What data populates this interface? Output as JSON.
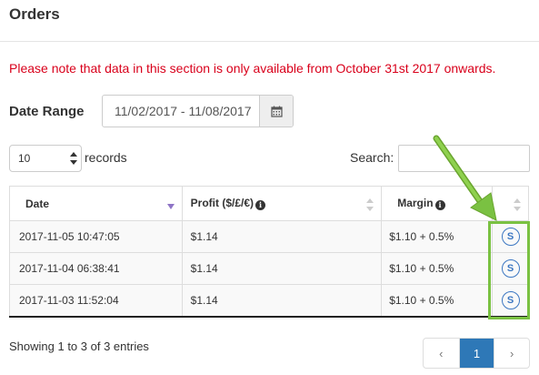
{
  "header": {
    "title": "Orders"
  },
  "notice": "Please note that data in this section is only available from October 31st 2017 onwards.",
  "date_range": {
    "label": "Date Range",
    "value": "11/02/2017 - 11/08/2017",
    "icon": "calendar-icon"
  },
  "length": {
    "value": "10",
    "suffix": "records"
  },
  "search": {
    "label": "Search:",
    "value": ""
  },
  "table": {
    "columns": [
      "Date",
      "Profit ($/£/€)",
      "Margin",
      ""
    ],
    "rows": [
      {
        "date": "2017-11-05 10:47:05",
        "profit": "$1.14",
        "margin": "$1.10 + 0.5%",
        "badge": "S"
      },
      {
        "date": "2017-11-04 06:38:41",
        "profit": "$1.14",
        "margin": "$1.10 + 0.5%",
        "badge": "S"
      },
      {
        "date": "2017-11-03 11:52:04",
        "profit": "$1.14",
        "margin": "$1.10 + 0.5%",
        "badge": "S"
      }
    ]
  },
  "footer": {
    "info": "Showing 1 to 3 of 3 entries",
    "pagination": {
      "prev": "‹",
      "current": "1",
      "next": "›"
    }
  },
  "colors": {
    "notice": "#d9001b",
    "accent": "#2e78b7",
    "highlight": "#7ac142",
    "sort_active": "#8e74c6",
    "badge": "#3c77c2"
  }
}
